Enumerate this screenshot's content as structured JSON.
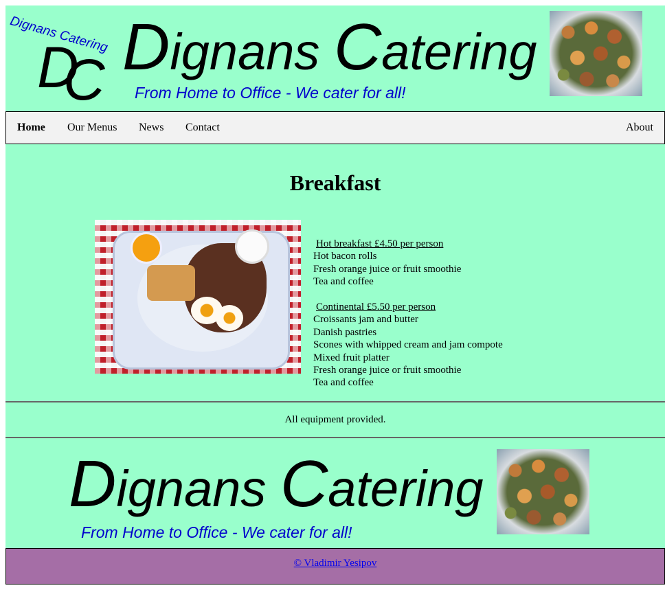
{
  "header": {
    "logo_arc_text": "Dignans Catering",
    "logo_letter_1": "D",
    "logo_letter_2": "C",
    "title_cap_1": "D",
    "title_rest_1": "ignans ",
    "title_cap_2": "C",
    "title_rest_2": "atering",
    "tagline": "From Home to Office - We cater for all!"
  },
  "nav": {
    "items": [
      {
        "label": "Home",
        "active": true
      },
      {
        "label": "Our Menus"
      },
      {
        "label": "News"
      },
      {
        "label": "Contact"
      }
    ],
    "right_item": "About"
  },
  "main": {
    "heading": "Breakfast",
    "menus": [
      {
        "title": "Hot breakfast £4.50 per person",
        "items": [
          "Hot bacon rolls",
          "Fresh orange juice or fruit smoothie",
          "Tea and coffee"
        ]
      },
      {
        "title": "Continental £5.50 per person",
        "items": [
          "Croissants jam and butter",
          "Danish pastries",
          "Scones with whipped cream and jam compote",
          "Mixed fruit platter",
          "Fresh orange juice or fruit smoothie",
          "Tea and coffee"
        ]
      }
    ]
  },
  "notice": "All equipment provided.",
  "footer": {
    "title_cap_1": "D",
    "title_rest_1": "ignans ",
    "title_cap_2": "C",
    "title_rest_2": "atering",
    "tagline": "From Home to Office - We cater for all!",
    "copyright": "© Vladimir Yesipov"
  },
  "colors": {
    "mint_background": "#99ffcc",
    "nav_background": "#f2f2f2",
    "tagline_blue": "#0000cc",
    "copyright_bar": "#a56ea6"
  },
  "icons": {
    "header_image": "catering-platter-image",
    "breakfast_image": "breakfast-tray-image"
  }
}
